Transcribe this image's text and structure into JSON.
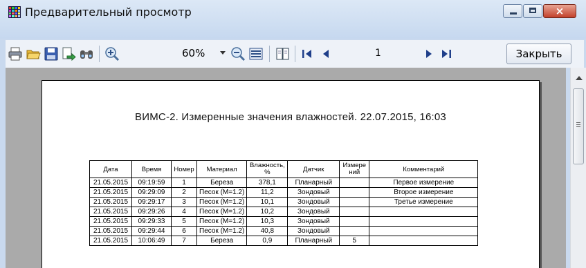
{
  "window": {
    "title": "Предварительный просмотр",
    "close_glyph": "×"
  },
  "toolbar": {
    "icons": [
      "printer-icon",
      "open-folder-icon",
      "save-icon",
      "export-icon",
      "find-icon",
      "zoom-in-icon",
      "zoom-out-icon",
      "fit-page-icon",
      "page-setup-icon",
      "first-page-icon",
      "prev-page-icon",
      "next-page-icon",
      "last-page-icon"
    ],
    "zoom_value": "60%",
    "page_number": "1",
    "close_label": "Закрыть"
  },
  "document": {
    "title": "ВИМС-2. Измеренные значения влажностей.  22.07.2015, 16:03",
    "table": {
      "headers": [
        "Дата",
        "Время",
        "Номер",
        "Материал",
        "Влажность, %",
        "Датчик",
        "Измерений",
        "Комментарий"
      ],
      "headers_display": [
        "Дата",
        "Время",
        "Номер",
        "Материал",
        "Влажность,\n%",
        "Датчик",
        "Измере\nний",
        "Комментарий"
      ],
      "rows": [
        [
          "21.05.2015",
          "09:19:59",
          "1",
          "Береза",
          "378,1",
          "Планарный",
          "",
          "Первое измерение"
        ],
        [
          "21.05.2015",
          "09:29:09",
          "2",
          "Песок (М=1.2)",
          "11,2",
          "Зондовый",
          "",
          "Второе измерение"
        ],
        [
          "21.05.2015",
          "09:29:17",
          "3",
          "Песок (М=1.2)",
          "10,1",
          "Зондовый",
          "",
          "Третье измерение"
        ],
        [
          "21.05.2015",
          "09:29:26",
          "4",
          "Песок (М=1.2)",
          "10,2",
          "Зондовый",
          "",
          ""
        ],
        [
          "21.05.2015",
          "09:29:33",
          "5",
          "Песок (М=1.2)",
          "10,3",
          "Зондовый",
          "",
          ""
        ],
        [
          "21.05.2015",
          "09:29:44",
          "6",
          "Песок (М=1.2)",
          "40,8",
          "Зондовый",
          "",
          ""
        ],
        [
          "21.05.2015",
          "10:06:49",
          "7",
          "Береза",
          "0,9",
          "Планарный",
          "5",
          ""
        ]
      ]
    }
  }
}
